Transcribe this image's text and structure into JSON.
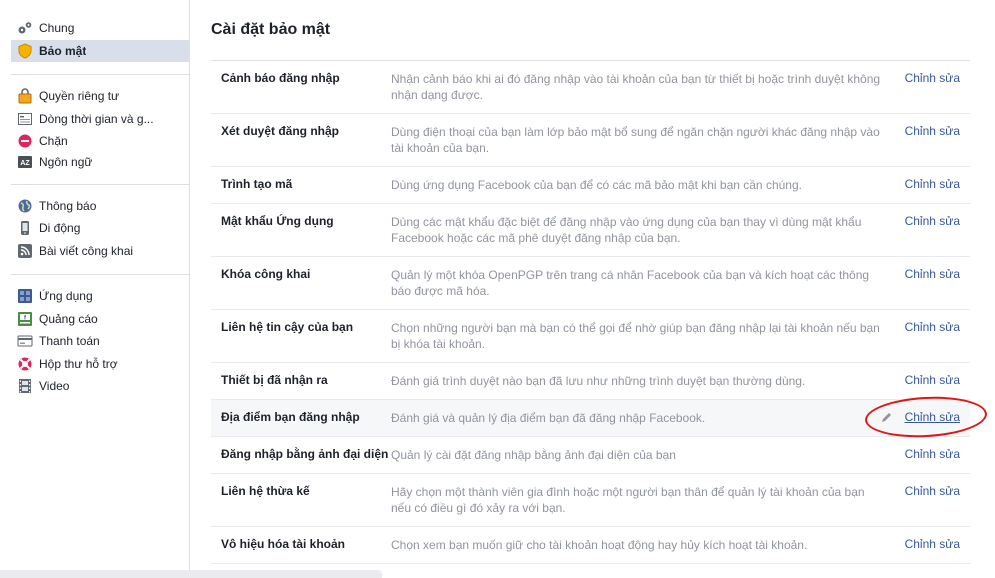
{
  "sidebar": {
    "groups": [
      [
        {
          "label": "Chung",
          "icon": "gears-icon",
          "active": false
        },
        {
          "label": "Bảo mật",
          "icon": "shield-icon",
          "active": true
        }
      ],
      [
        {
          "label": "Quyền riêng tư",
          "icon": "lock-icon",
          "active": false
        },
        {
          "label": "Dòng thời gian và g...",
          "icon": "timeline-icon",
          "active": false
        },
        {
          "label": "Chặn",
          "icon": "block-icon",
          "active": false
        },
        {
          "label": "Ngôn ngữ",
          "icon": "language-icon",
          "active": false
        }
      ],
      [
        {
          "label": "Thông báo",
          "icon": "globe-icon",
          "active": false
        },
        {
          "label": "Di động",
          "icon": "mobile-icon",
          "active": false
        },
        {
          "label": "Bài viết công khai",
          "icon": "rss-icon",
          "active": false
        }
      ],
      [
        {
          "label": "Ứng dụng",
          "icon": "apps-icon",
          "active": false
        },
        {
          "label": "Quảng cáo",
          "icon": "ads-icon",
          "active": false
        },
        {
          "label": "Thanh toán",
          "icon": "credit-card-icon",
          "active": false
        },
        {
          "label": "Hộp thư hỗ trợ",
          "icon": "lifebuoy-icon",
          "active": false
        },
        {
          "label": "Video",
          "icon": "film-icon",
          "active": false
        }
      ]
    ]
  },
  "main": {
    "title": "Cài đặt bảo mật",
    "edit_label": "Chỉnh sửa",
    "rows": [
      {
        "label": "Cảnh báo đăng nhập",
        "desc": "Nhận cảnh báo khi ai đó đăng nhập vào tài khoản của bạn từ thiết bị hoặc trình duyệt không nhận dạng được.",
        "edit": "Chỉnh sửa"
      },
      {
        "label": "Xét duyệt đăng nhập",
        "desc": "Dùng điện thoại của bạn làm lớp bảo mật bổ sung để ngăn chặn người khác đăng nhập vào tài khoản của bạn.",
        "edit": "Chỉnh sửa"
      },
      {
        "label": "Trình tạo mã",
        "desc": "Dùng ứng dụng Facebook của bạn để có các mã bảo mật khi bạn cần chúng.",
        "edit": "Chỉnh sửa"
      },
      {
        "label": "Mật khẩu Ứng dụng",
        "desc": "Dùng các mật khẩu đặc biệt để đăng nhập vào ứng dụng của bạn thay vì dùng mật khẩu Facebook hoặc các mã phê duyệt đăng nhập của bạn.",
        "edit": "Chỉnh sửa"
      },
      {
        "label": "Khóa công khai",
        "desc": "Quản lý một khóa OpenPGP trên trang cá nhân Facebook của bạn và kích hoạt các thông báo được mã hóa.",
        "edit": "Chỉnh sửa"
      },
      {
        "label": "Liên hệ tin cậy của bạn",
        "desc": "Chọn những người bạn mà bạn có thể gọi để nhờ giúp bạn đăng nhập lại tài khoản nếu bạn bị khóa tài khoản.",
        "edit": "Chỉnh sửa"
      },
      {
        "label": "Thiết bị đã nhận ra",
        "desc": "Đánh giá trình duyệt nào bạn đã lưu như những trình duyệt bạn thường dùng.",
        "edit": "Chỉnh sửa"
      },
      {
        "label": "Địa điểm bạn đăng nhập",
        "desc": "Đánh giá và quản lý địa điểm bạn đã đăng nhập Facebook.",
        "edit": "Chỉnh sửa"
      },
      {
        "label": "Đăng nhập bằng ảnh đại diện",
        "desc": "Quản lý cài đặt đăng nhập bằng ảnh đại diện của bạn",
        "edit": "Chỉnh sửa"
      },
      {
        "label": "Liên hệ thừa kế",
        "desc": "Hãy chọn một thành viên gia đình hoặc một người bạn thân để quản lý tài khoản của bạn nếu có điều gì đó xảy ra với bạn.",
        "edit": "Chỉnh sửa"
      },
      {
        "label": "Vô hiệu hóa tài khoản",
        "desc": "Chọn xem bạn muốn giữ cho tài khoản hoạt động hay hủy kích hoạt tài khoản.",
        "edit": "Chỉnh sửa"
      }
    ]
  }
}
